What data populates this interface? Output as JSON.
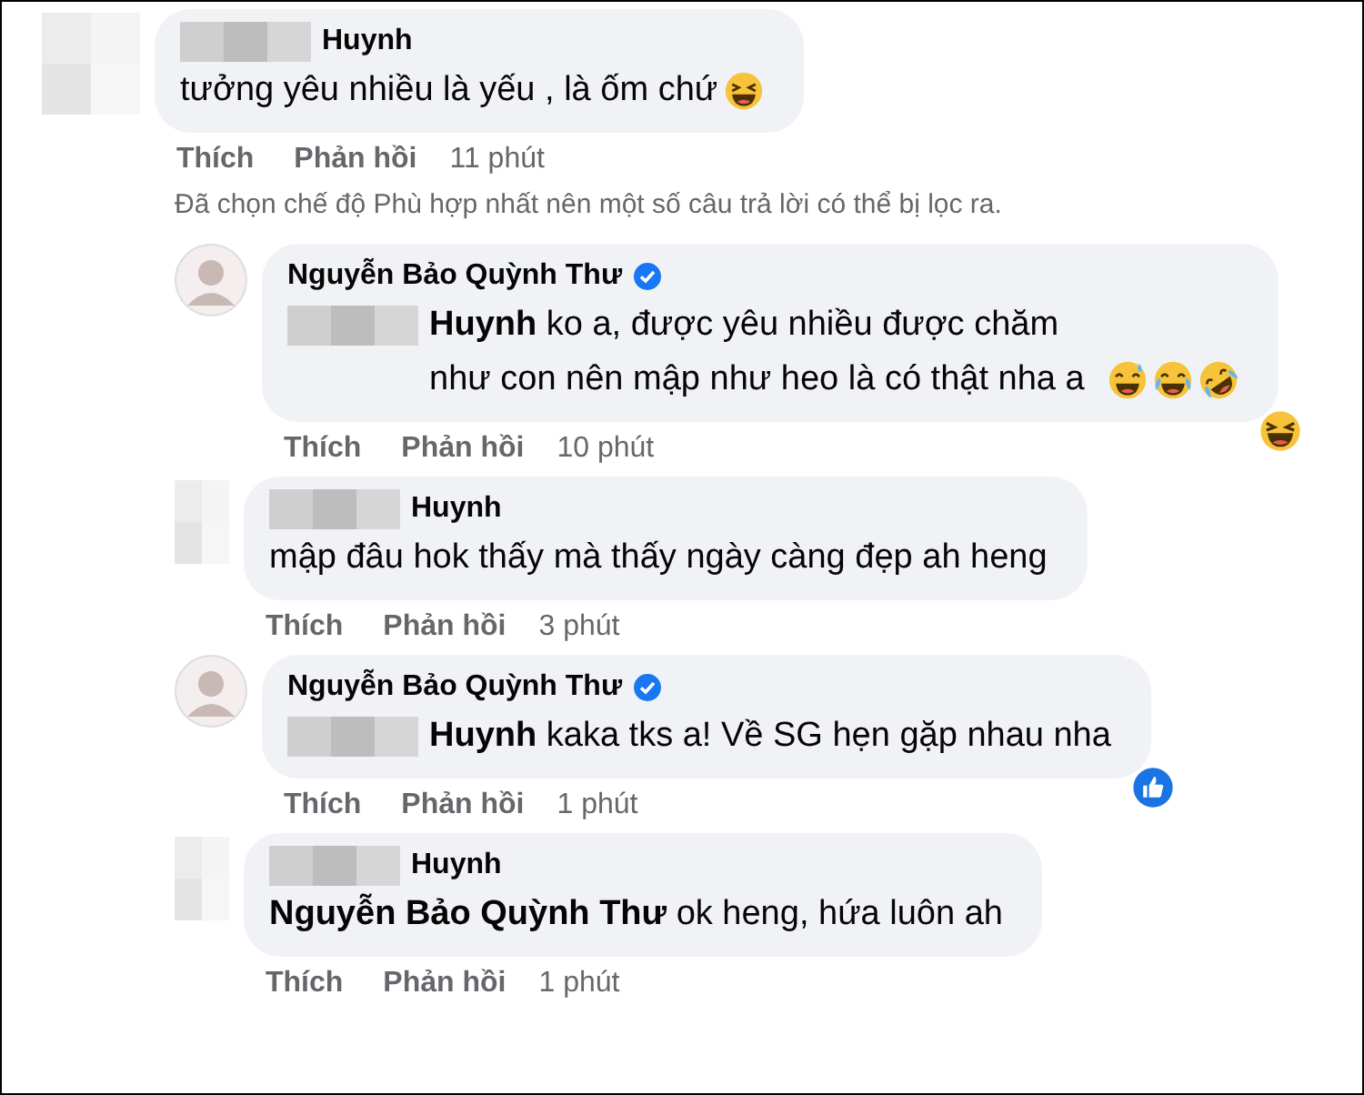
{
  "comments": [
    {
      "avatar": {
        "kind": "blurred"
      },
      "name_prefix": {
        "kind": "blurred"
      },
      "name": "Huynh",
      "body": "tưởng yêu nhiều là yếu , là ốm chứ",
      "emojis": [
        {
          "kind": "squint"
        }
      ],
      "actions": [
        "Thích",
        "Phản hồi"
      ],
      "time": "11 phút",
      "notice": "Đã chọn chế độ Phù hợp nhất nên một số câu trả lời có thể bị lọc ra.",
      "children": [
        {
          "avatar": {
            "kind": "photo"
          },
          "name": "Nguyễn Bảo Quỳnh Thư",
          "verified": true,
          "mention_prefix": {
            "kind": "blurred"
          },
          "body": "**Huynh** ko a, được yêu nhiều được chăm như con nên mập như heo là có thật nha a",
          "emojis": [
            {
              "kind": "sweat"
            },
            {
              "kind": "joy"
            },
            {
              "kind": "rofl"
            }
          ],
          "reaction": {
            "kind": "haha"
          },
          "actions": [
            "Thích",
            "Phản hồi"
          ],
          "time": "10 phút"
        },
        {
          "avatar": {
            "kind": "blurred"
          },
          "name_prefix": {
            "kind": "blurred"
          },
          "name": "Huynh",
          "body": "mập đâu hok thấy mà thấy ngày càng đẹp ah heng",
          "actions": [
            "Thích",
            "Phản hồi"
          ],
          "time": "3 phút"
        },
        {
          "avatar": {
            "kind": "photo"
          },
          "name": "Nguyễn Bảo Quỳnh Thư",
          "verified": true,
          "mention_prefix": {
            "kind": "blurred"
          },
          "body": "**Huynh** kaka tks a! Về SG hẹn gặp nhau nha",
          "reaction": {
            "kind": "like"
          },
          "actions": [
            "Thích",
            "Phản hồi"
          ],
          "time": "1 phút"
        },
        {
          "avatar": {
            "kind": "blurred"
          },
          "name_prefix": {
            "kind": "blurred"
          },
          "name": "Huynh",
          "body": "**Nguyễn Bảo Quỳnh Thư** ok heng, hứa luôn ah",
          "actions": [
            "Thích",
            "Phản hồi"
          ],
          "time": "1 phút"
        }
      ]
    }
  ]
}
